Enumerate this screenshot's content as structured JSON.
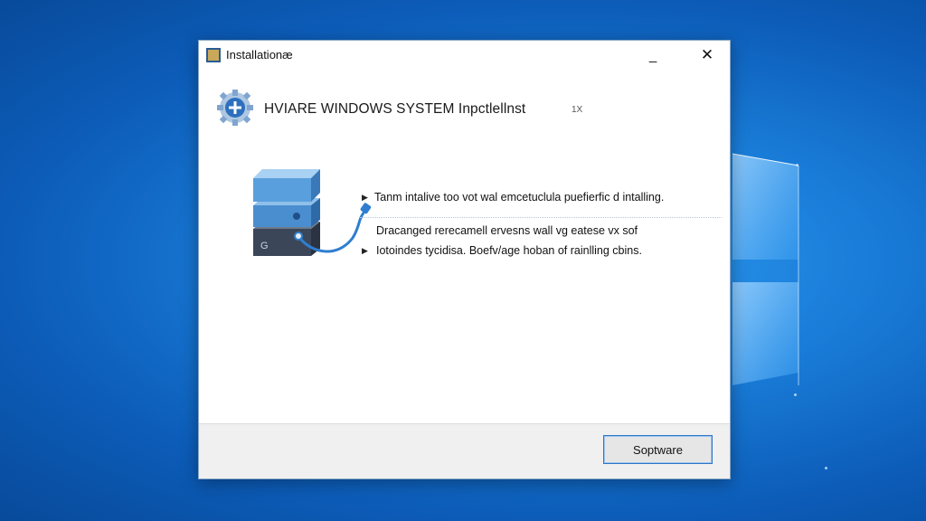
{
  "window": {
    "title": "Installationæ",
    "minimize_glyph": "_",
    "close_glyph": "✕"
  },
  "header": {
    "title": "HVIARE WINDOWS SYSTEM Inpctlellnst",
    "aux_text": "1X",
    "icon": "installer-gear-icon"
  },
  "content": {
    "illustration": "server-stack-icon",
    "lines": [
      "Tanm intalive too vot wal emcetuclula puefierfic d intalling.",
      "Dracanged rerecamell ervesns wall vg eatese vx sof",
      "Iotoindes tycidisa. Boefv/age hoban of rainlling cbins."
    ],
    "bullet_glyph": "▶"
  },
  "footer": {
    "button_label": "Soptware"
  },
  "colors": {
    "desktop_accent": "#1a7ed9",
    "button_border": "#2f76c9",
    "server_blue": "#4a8ed0"
  }
}
